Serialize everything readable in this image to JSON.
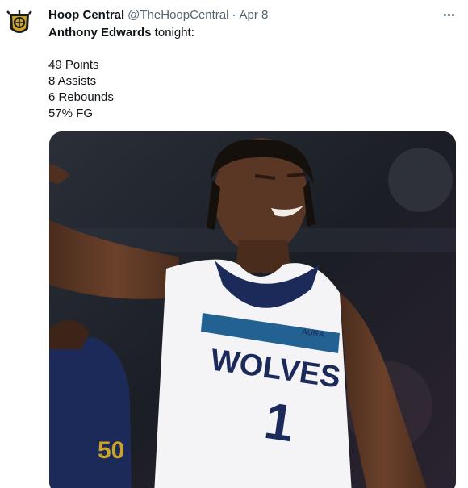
{
  "tweet": {
    "author_name": "Hoop Central",
    "handle": "@TheHoopCentral",
    "separator": "·",
    "date": "Apr 8",
    "text_name": "Anthony Edwards",
    "text_rest": " tonight:",
    "stats": [
      "49 Points",
      "8 Assists",
      "6 Rebounds",
      "57% FG"
    ]
  },
  "media": {
    "jersey_text": "WOLVES",
    "jersey_number": "1",
    "jersey_brand": "AURA",
    "other_jersey_number": "50"
  },
  "colors": {
    "accent_navy": "#1c2a5a",
    "jersey_blue": "#236192",
    "logo_gold": "#c9a227"
  },
  "icons": [
    "hoop-central-logo-icon",
    "more-options-icon"
  ]
}
